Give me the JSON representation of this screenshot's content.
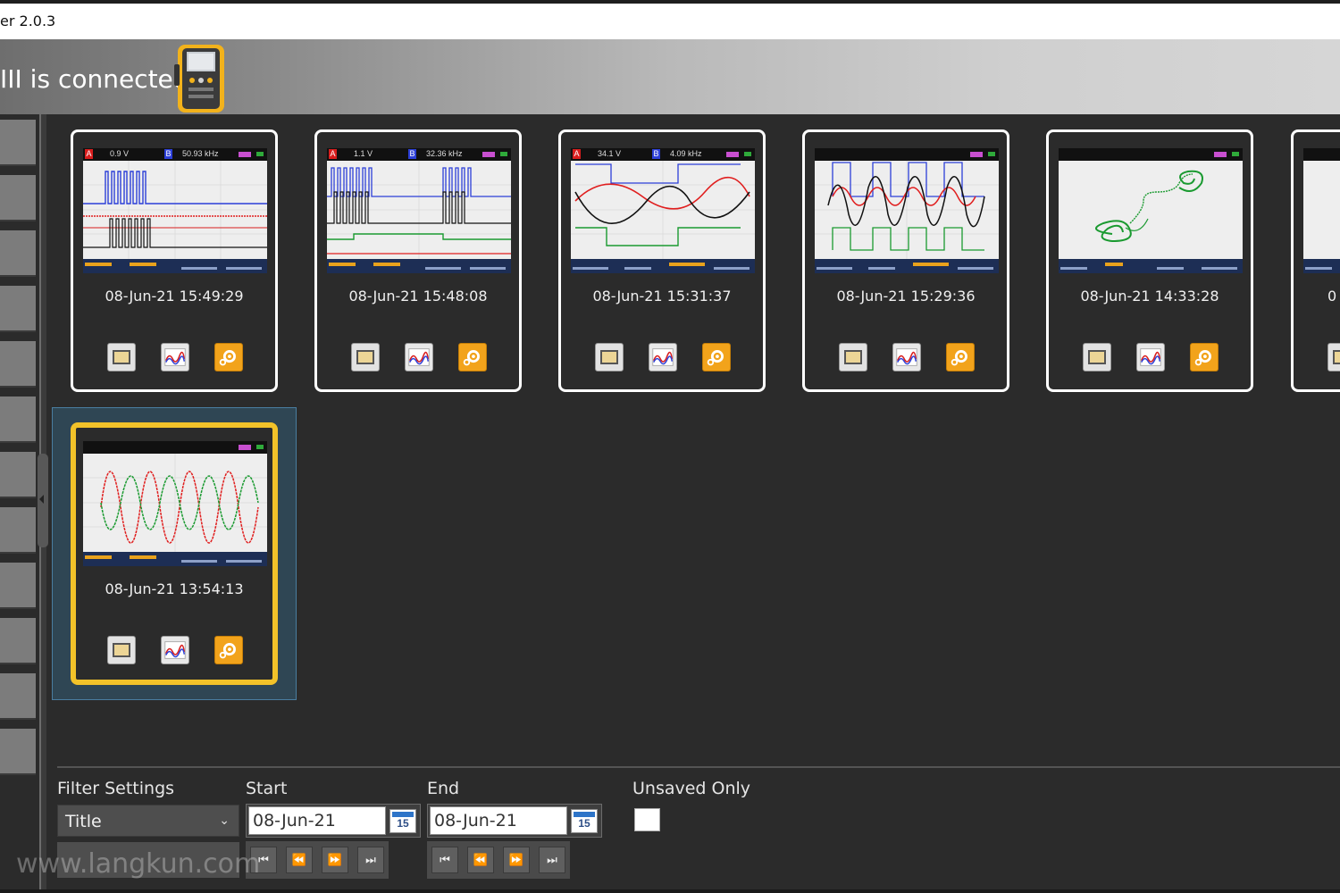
{
  "window": {
    "title": "er 2.0.3"
  },
  "banner": {
    "connection_text": "III is connected",
    "device_icon": "scopemeter-device-icon"
  },
  "thumbnails": [
    {
      "timestamp": "08-Jun-21 15:49:29",
      "ch_a": "A",
      "ch_a_reading": "0.9 V",
      "ch_b": "B",
      "ch_b_reading": "50.93 kHz",
      "selected": false
    },
    {
      "timestamp": "08-Jun-21 15:48:08",
      "ch_a": "A",
      "ch_a_reading": "1.1 V",
      "ch_b": "B",
      "ch_b_reading": "32.36 kHz",
      "selected": false
    },
    {
      "timestamp": "08-Jun-21 15:31:37",
      "ch_a": "A",
      "ch_a_reading": "34.1 V",
      "ch_b": "B",
      "ch_b_reading": "4.09 kHz",
      "selected": false
    },
    {
      "timestamp": "08-Jun-21 15:29:36",
      "selected": false
    },
    {
      "timestamp": "08-Jun-21 14:33:28",
      "selected": false
    },
    {
      "timestamp": "0",
      "selected": false
    },
    {
      "timestamp": "08-Jun-21 13:54:13",
      "selected": true
    }
  ],
  "card_buttons": {
    "screen_icon": "screen-view-icon",
    "waveform_icon": "waveform-icon",
    "settings_icon": "settings-gear-icon"
  },
  "filter": {
    "label": "Filter Settings",
    "field_value": "Title",
    "start_label": "Start",
    "start_value": "08-Jun-21",
    "end_label": "End",
    "end_value": "08-Jun-21",
    "calendar_day": "15",
    "unsaved_label": "Unsaved Only",
    "unsaved_checked": false
  },
  "nav_buttons": [
    "first",
    "previous",
    "next",
    "last"
  ],
  "watermark": "www.langkun.com",
  "colors": {
    "accent_selected": "#f2c229",
    "gear_orange": "#f2a31b",
    "background": "#2b2b2b"
  }
}
